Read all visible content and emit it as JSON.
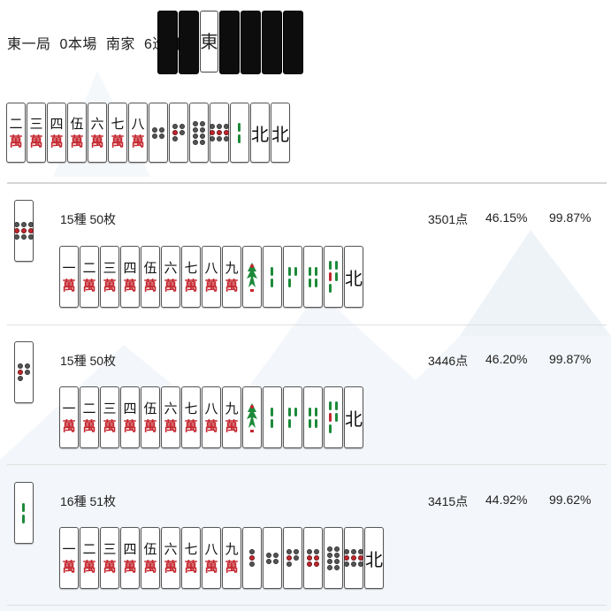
{
  "header": {
    "round": "東一局",
    "honba": "0本場",
    "seat": "南家",
    "turn": "6巡目"
  },
  "dora_indicator": {
    "revealed": "東",
    "hidden_count": 6
  },
  "hand": [
    {
      "suit": "man",
      "num": "二"
    },
    {
      "suit": "man",
      "num": "三"
    },
    {
      "suit": "man",
      "num": "四"
    },
    {
      "suit": "man",
      "num": "伍"
    },
    {
      "suit": "man",
      "num": "六"
    },
    {
      "suit": "man",
      "num": "七"
    },
    {
      "suit": "man",
      "num": "八"
    },
    {
      "suit": "pin",
      "n": 4
    },
    {
      "suit": "pin",
      "n": 5
    },
    {
      "suit": "pin",
      "n": 8
    },
    {
      "suit": "pin",
      "n": 9
    },
    {
      "suit": "sou",
      "n": 2
    },
    {
      "suit": "wind",
      "char": "北"
    },
    {
      "suit": "wind",
      "char": "北"
    }
  ],
  "candidates": [
    {
      "discard": {
        "suit": "pin",
        "n": 9
      },
      "kinds": "15種 50枚",
      "points": "3501点",
      "p1": "46.15%",
      "p2": "99.87%",
      "tiles": [
        {
          "suit": "man",
          "num": "一"
        },
        {
          "suit": "man",
          "num": "二"
        },
        {
          "suit": "man",
          "num": "三"
        },
        {
          "suit": "man",
          "num": "四"
        },
        {
          "suit": "man",
          "num": "伍"
        },
        {
          "suit": "man",
          "num": "六"
        },
        {
          "suit": "man",
          "num": "七"
        },
        {
          "suit": "man",
          "num": "八"
        },
        {
          "suit": "man",
          "num": "九"
        },
        {
          "suit": "sou",
          "n": 1
        },
        {
          "suit": "sou",
          "n": 2
        },
        {
          "suit": "sou",
          "n": 3
        },
        {
          "suit": "sou",
          "n": 4
        },
        {
          "suit": "sou",
          "n": 5
        },
        {
          "suit": "wind",
          "char": "北"
        }
      ]
    },
    {
      "discard": {
        "suit": "pin",
        "n": 5
      },
      "kinds": "15種 50枚",
      "points": "3446点",
      "p1": "46.20%",
      "p2": "99.87%",
      "tiles": [
        {
          "suit": "man",
          "num": "一"
        },
        {
          "suit": "man",
          "num": "二"
        },
        {
          "suit": "man",
          "num": "三"
        },
        {
          "suit": "man",
          "num": "四"
        },
        {
          "suit": "man",
          "num": "伍"
        },
        {
          "suit": "man",
          "num": "六"
        },
        {
          "suit": "man",
          "num": "七"
        },
        {
          "suit": "man",
          "num": "八"
        },
        {
          "suit": "man",
          "num": "九"
        },
        {
          "suit": "sou",
          "n": 1
        },
        {
          "suit": "sou",
          "n": 2
        },
        {
          "suit": "sou",
          "n": 3
        },
        {
          "suit": "sou",
          "n": 4
        },
        {
          "suit": "sou",
          "n": 5
        },
        {
          "suit": "wind",
          "char": "北"
        }
      ]
    },
    {
      "discard": {
        "suit": "sou",
        "n": 2
      },
      "kinds": "16種 51枚",
      "points": "3415点",
      "p1": "44.92%",
      "p2": "99.62%",
      "tiles": [
        {
          "suit": "man",
          "num": "一"
        },
        {
          "suit": "man",
          "num": "二"
        },
        {
          "suit": "man",
          "num": "三"
        },
        {
          "suit": "man",
          "num": "四"
        },
        {
          "suit": "man",
          "num": "伍"
        },
        {
          "suit": "man",
          "num": "六"
        },
        {
          "suit": "man",
          "num": "七"
        },
        {
          "suit": "man",
          "num": "八"
        },
        {
          "suit": "man",
          "num": "九"
        },
        {
          "suit": "pin",
          "n": 3
        },
        {
          "suit": "pin",
          "n": 4
        },
        {
          "suit": "pin",
          "n": 5
        },
        {
          "suit": "pin",
          "n": 6
        },
        {
          "suit": "pin",
          "n": 8
        },
        {
          "suit": "pin",
          "n": 9
        },
        {
          "suit": "wind",
          "char": "北"
        }
      ]
    }
  ]
}
